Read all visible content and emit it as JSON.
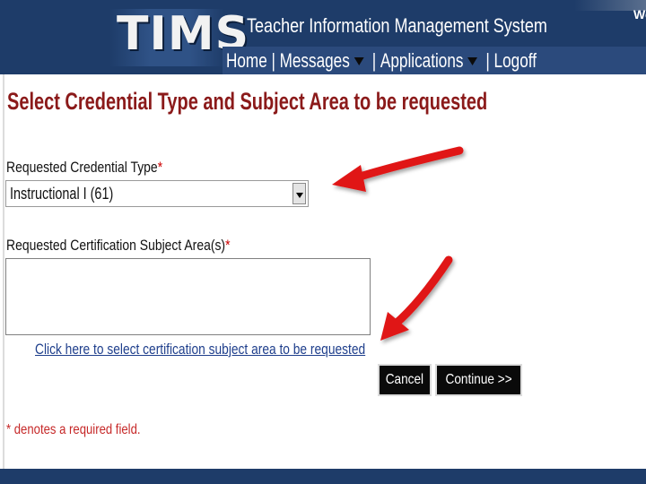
{
  "header": {
    "logo": "TIMS",
    "system_title": "Teacher Information Management System",
    "welcome": "We",
    "nav": {
      "home": "Home",
      "messages": "Messages",
      "applications": "Applications",
      "logoff": "Logoff",
      "separator": "|"
    }
  },
  "form": {
    "title": "Select Credential Type and Subject Area to be requested",
    "credential_label": "Requested Credential Type",
    "credential_value": "Instructional I (61)",
    "subject_label": "Requested Certification Subject Area(s)",
    "required_mark": "*",
    "subject_link": "Click here to select certification subject area to be requested",
    "cancel_label": "Cancel",
    "continue_label": "Continue >>",
    "required_note": "* denotes a required field."
  },
  "colors": {
    "header_bg": "#1e3c69",
    "title_color": "#8b1a1a",
    "required_color": "#cc0000",
    "link_color": "#1f3f8c",
    "annotation_arrow": "#e01818"
  },
  "icons": {
    "dropdown": "chevron-down-icon",
    "nav_menu": "caret-down-icon",
    "annotation": "red-arrow-icon"
  }
}
